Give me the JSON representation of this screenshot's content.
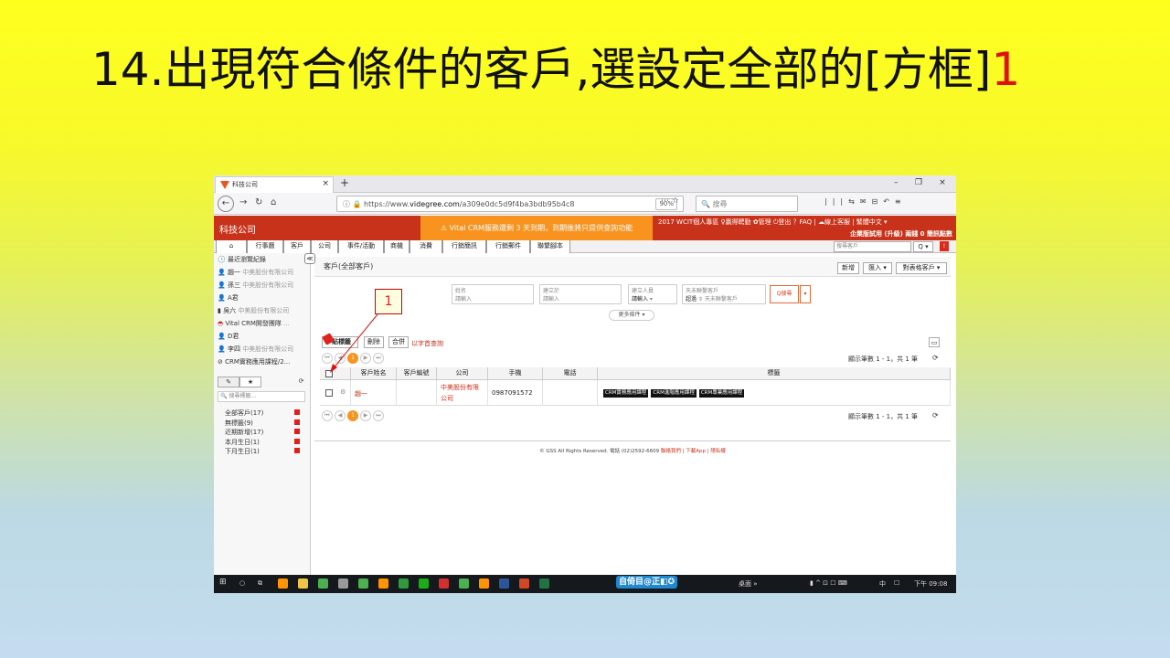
{
  "slide": {
    "title": "14.出現符合條件的客戶,選設定全部的[方框]",
    "step_num": "1",
    "callout": "1"
  },
  "browser": {
    "tab_title": "科技公司",
    "url_prefix": "https://www.",
    "url_host": "videgree.com",
    "url_rest": "/a309e0dc5d9f4ba3bdb95b4c8",
    "zoom": "90%",
    "search_placeholder": "搜尋",
    "new_tab": "+",
    "tab_close": "×",
    "min": "–",
    "max": "❐",
    "close": "×"
  },
  "crm": {
    "brand": "科技公司",
    "notice": "⚠ Vital CRM服務還剩 3 天到期，到期後將只提供查詢功能",
    "top_links": "2017 WCIT個人專區 ♀贏得聘勤 ✿管理 ⏻登出 ？FAQ | ☁線上客服 | 繁體中文 ▾",
    "plan": "企業版試用 (升級) 兩錢 0 簡訊點數",
    "menu": [
      "行事曆",
      "客戶",
      "公司",
      "事件/活動",
      "商機",
      "消費",
      "行銷簡訊",
      "行銷郵件",
      "聯繫腳本"
    ],
    "quick_search": "搜尋客戶",
    "quick_btn": "Q ▾",
    "quick_red": "!"
  },
  "sidebar": {
    "recent_title": "最近瀏覽紀錄",
    "recent": [
      {
        "name": "趙一",
        "company": "中美股份有限公司"
      },
      {
        "name": "孫三",
        "company": "中美股份有限公司"
      },
      {
        "name": "A君",
        "company": ""
      },
      {
        "name": "吳六",
        "company": "中美股份有限公司"
      },
      {
        "name": "Vital CRM開發團隊",
        "company": "..."
      },
      {
        "name": "D君",
        "company": ""
      },
      {
        "name": "李四",
        "company": "中美股份有限公司"
      },
      {
        "name": "CRM實務應用課程/2...",
        "company": ""
      }
    ],
    "tab_tag": "✎",
    "tab_star": "★",
    "refresh": "⟳",
    "search_placeholder": "搜尋標籤...",
    "filters": [
      "全部客戶(17)",
      "無標籤(9)",
      "近期新增(17)",
      "本月生日(1)",
      "下月生日(1)"
    ]
  },
  "main": {
    "title": "客戶(全部客戶)",
    "btn_new": "新增",
    "btn_import": "匯入 ▾",
    "btn_export": "對表格客戶 ▾",
    "f_name_label": "姓名",
    "f_name_ph": "請輸入",
    "f_create_label": "建立於",
    "f_create_ph": "請輸入",
    "f_creator_label": "建立人員",
    "f_creator_val": "請輸入",
    "f_contact_label": "天未聯繫客戶",
    "f_contact_val": "超過",
    "f_contact_unit": "天未聯繫客戶",
    "search_btn": "Q搜尋",
    "search_dd": "▾",
    "more": "更多條件 ▾",
    "tag_btn": "貼標籤",
    "del_btn": "刪除",
    "merge_btn": "合併",
    "star_link": "以字首查詢",
    "box_btn": "▭",
    "page": "1",
    "show_count": "顯示筆數 1 - 1，共 1 筆",
    "refresh": "⟳",
    "columns": [
      "客戶姓名",
      "客戶編號",
      "公司",
      "手機",
      "電話",
      "標籤"
    ],
    "row": {
      "name": "趙一",
      "id": "",
      "company": "中美股份有限公司",
      "mobile": "0987091572",
      "phone": "",
      "gear": "⚙",
      "tags": [
        "CRM實務應用課程",
        "CRM進階應用課程",
        "CRM專業應用課程"
      ]
    },
    "footer_text": "© GSS All Rights Reserved. 電話 (02)2592-6609 ",
    "footer_links": "聯絡我們 | 下載App | 隱私權",
    "footer_sep": ""
  },
  "taskbar": {
    "ime": "自倚目@正◧✪",
    "desktop": "桌面 »",
    "lang": "中",
    "time": "下午 09:08"
  },
  "colors": {
    "crm_red": "#c8321a",
    "notice_orange": "#f7931e",
    "tag_badge": "#111111"
  }
}
